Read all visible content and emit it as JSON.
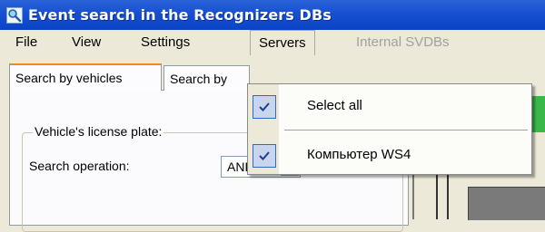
{
  "window": {
    "title": "Event search in the Recognizers DBs",
    "icon": "search-magnifier-icon"
  },
  "menubar": {
    "items": [
      {
        "label": "File"
      },
      {
        "label": "View"
      },
      {
        "label": "Settings"
      },
      {
        "label": "Servers"
      },
      {
        "label": "Internal SVDBs"
      }
    ]
  },
  "tabs": [
    {
      "label": "Search by vehicles"
    },
    {
      "label": "Search by"
    }
  ],
  "search_form": {
    "group_title": "Vehicle's license plate:",
    "operation_label": "Search operation:",
    "operation_value": "AND"
  },
  "servers_menu": {
    "items": [
      {
        "label": "Select all",
        "checked": true
      },
      {
        "label": "Компьютер WS4",
        "checked": true
      }
    ]
  },
  "colors": {
    "titlebar": "#0a44c6",
    "menu_background": "#ece9d8",
    "check_highlight": "#316ac5",
    "active_tab_accent": "#e68b2c"
  }
}
